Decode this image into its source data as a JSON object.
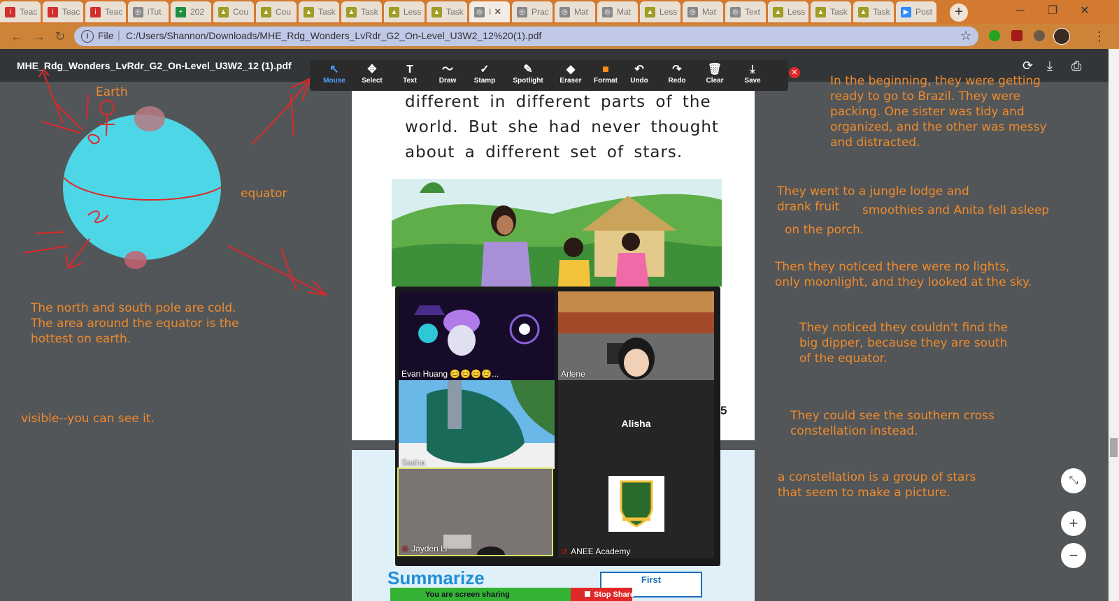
{
  "browser": {
    "tabs": [
      {
        "label": "Teac",
        "icon": "i",
        "icon_color": "#d32f2f"
      },
      {
        "label": "Teac",
        "icon": "i",
        "icon_color": "#d32f2f"
      },
      {
        "label": "Teac",
        "icon": "i",
        "icon_color": "#d32f2f"
      },
      {
        "label": "iTut",
        "icon": "◎",
        "icon_color": "#888888"
      },
      {
        "label": "202",
        "icon": "+",
        "icon_color": "#1e8e3e"
      },
      {
        "label": "Cou",
        "icon": "▲",
        "icon_color": "#9e9d24"
      },
      {
        "label": "Cou",
        "icon": "▲",
        "icon_color": "#9e9d24"
      },
      {
        "label": "Task",
        "icon": "▲",
        "icon_color": "#9e9d24"
      },
      {
        "label": "Task",
        "icon": "▲",
        "icon_color": "#9e9d24"
      },
      {
        "label": "Less",
        "icon": "▲",
        "icon_color": "#9e9d24"
      },
      {
        "label": "Task",
        "icon": "▲",
        "icon_color": "#9e9d24"
      },
      {
        "label": "I",
        "icon": "◎",
        "icon_color": "#888888",
        "active": true
      },
      {
        "label": "Prac",
        "icon": "◎",
        "icon_color": "#888888"
      },
      {
        "label": "Mat",
        "icon": "◎",
        "icon_color": "#888888"
      },
      {
        "label": "Mat",
        "icon": "◎",
        "icon_color": "#888888"
      },
      {
        "label": "Less",
        "icon": "▲",
        "icon_color": "#9e9d24"
      },
      {
        "label": "Mat",
        "icon": "◎",
        "icon_color": "#888888"
      },
      {
        "label": "Text",
        "icon": "◎",
        "icon_color": "#888888"
      },
      {
        "label": "Less",
        "icon": "▲",
        "icon_color": "#9e9d24"
      },
      {
        "label": "Task",
        "icon": "▲",
        "icon_color": "#9e9d24"
      },
      {
        "label": "Task",
        "icon": "▲",
        "icon_color": "#9e9d24"
      },
      {
        "label": "Post",
        "icon": "▶",
        "icon_color": "#2d8cff"
      }
    ],
    "new_tab": "+",
    "omnibox_file_label": "File",
    "url": "C:/Users/Shannon/Downloads/MHE_Rdg_Wonders_LvRdr_G2_On-Level_U3W2_12%20(1).pdf"
  },
  "pdf": {
    "title": "MHE_Rdg_Wonders_LvRdr_G2_On-Level_U3W2_12 (1).pdf",
    "lines": [
      "different in different parts of the",
      "world. But she had never thought",
      "about a different set of stars."
    ],
    "page_number": "5",
    "summarize_heading": "Summarize",
    "first_label": "First"
  },
  "annotate_tools": [
    {
      "label": "Mouse",
      "glyph": "↖",
      "selected": true
    },
    {
      "label": "Select",
      "glyph": "✥"
    },
    {
      "label": "Text",
      "glyph": "T"
    },
    {
      "label": "Draw",
      "glyph": "〜"
    },
    {
      "label": "Stamp",
      "glyph": "✓"
    },
    {
      "label": "Spotlight",
      "glyph": "✎"
    },
    {
      "label": "Eraser",
      "glyph": "◆"
    },
    {
      "label": "Format",
      "glyph": "■"
    },
    {
      "label": "Undo",
      "glyph": "↶"
    },
    {
      "label": "Redo",
      "glyph": "↷"
    },
    {
      "label": "Clear",
      "glyph": "🗑"
    },
    {
      "label": "Save",
      "glyph": "⤓"
    }
  ],
  "participants": [
    {
      "name": "Evan Huang 😊😊😊😊..."
    },
    {
      "name": "Arlene"
    },
    {
      "name": "Sasha"
    },
    {
      "name": "Alisha"
    },
    {
      "name": "Jayden Li"
    },
    {
      "name": "ANEE Academy"
    }
  ],
  "share": {
    "status": "You are screen sharing",
    "stop": "Stop Share"
  },
  "drawing_labels": {
    "earth": "Earth",
    "equator": "equator"
  },
  "notes_left": {
    "poles_1": "The north and south pole are cold.",
    "poles_2": "The area around the equator is the",
    "poles_3": "hottest on earth.",
    "visible": "visible--you can see it."
  },
  "notes_right": {
    "n1_1": "In the beginning, they were getting",
    "n1_2": "ready to go to Brazil. They were",
    "n1_3": "packing.  One sister was tidy and",
    "n1_4": "organized, and the other was messy",
    "n1_5": "and distracted.",
    "n2_1": "They went to a jungle lodge and",
    "n2_2": "drank fruit",
    "n2_3": "smoothies and Anita fell asleep",
    "n2_4": "on the porch.",
    "n3_1": "Then they noticed there were no lights,",
    "n3_2": "only moonlight, and they looked at the sky.",
    "n4_1": "They noticed they couldn't find the",
    "n4_2": "big dipper, because they are south",
    "n4_3": "of the equator.",
    "n5_1": "They could see the southern cross",
    "n5_2": "constellation instead.",
    "n6_1": "a constellation is a group of stars",
    "n6_2": "that seem to make a picture."
  },
  "colors": {
    "annotation_text": "#f08a2a",
    "pen": "#e02828",
    "globe": "#4dd6e6",
    "share_green": "#34b233"
  }
}
